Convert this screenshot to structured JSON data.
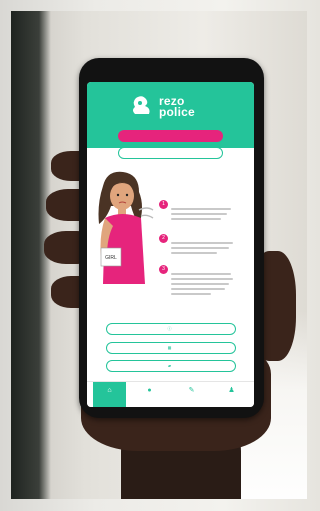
{
  "app": {
    "logo_line1": "rezo",
    "logo_line2": "police",
    "logo_sub": "",
    "primary_button": "",
    "secondary_button": ""
  },
  "section": {
    "title": "",
    "steps": [
      {
        "number": "1",
        "title": ""
      },
      {
        "number": "2",
        "title": ""
      },
      {
        "number": "3",
        "title": ""
      }
    ]
  },
  "sign": {
    "text": "GIRL"
  },
  "buttons": [
    {
      "icon": "info-icon",
      "label": ""
    },
    {
      "icon": "calendar-icon",
      "label": ""
    },
    {
      "icon": "chat-icon",
      "label": ""
    }
  ],
  "tabs": [
    {
      "icon": "home-icon",
      "label": ""
    },
    {
      "icon": "alert-icon",
      "label": ""
    },
    {
      "icon": "pen-icon",
      "label": ""
    },
    {
      "icon": "user-icon",
      "label": ""
    }
  ],
  "colors": {
    "accent": "#24c49a",
    "highlight": "#e6247c"
  }
}
